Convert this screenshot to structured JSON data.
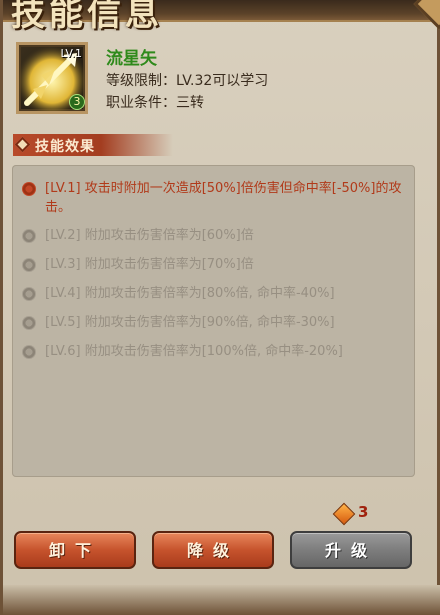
{
  "window": {
    "title": "技能信息"
  },
  "skill": {
    "level_tag": "LV.1",
    "icon": "arrow-icon",
    "count": "3",
    "name": "流星矢",
    "level_req": "等级限制：LV.32可以学习",
    "job_req": "职业条件：三转"
  },
  "effects_section": {
    "title": "技能效果",
    "items": [
      {
        "text": "[LV.1] 攻击时附加一次造成[50%]倍伤害但命中率[-50%]的攻击。",
        "active": true
      },
      {
        "text": "[LV.2] 附加攻击伤害倍率为[60%]倍",
        "active": false
      },
      {
        "text": "[LV.3] 附加攻击伤害倍率为[70%]倍",
        "active": false
      },
      {
        "text": "[LV.4] 附加攻击伤害倍率为[80%倍, 命中率-40%]",
        "active": false
      },
      {
        "text": "[LV.5] 附加攻击伤害倍率为[90%倍, 命中率-30%]",
        "active": false
      },
      {
        "text": "[LV.6] 附加攻击伤害倍率为[100%倍, 命中率-20%]",
        "active": false
      }
    ]
  },
  "cost": {
    "icon": "gem-icon",
    "value": "3"
  },
  "buttons": {
    "unequip": "卸下",
    "downgrade": "降级",
    "upgrade": "升级"
  },
  "colors": {
    "active_text": "#b13a1a",
    "inactive_text": "#978f82",
    "skill_name": "#2f8a1b"
  }
}
